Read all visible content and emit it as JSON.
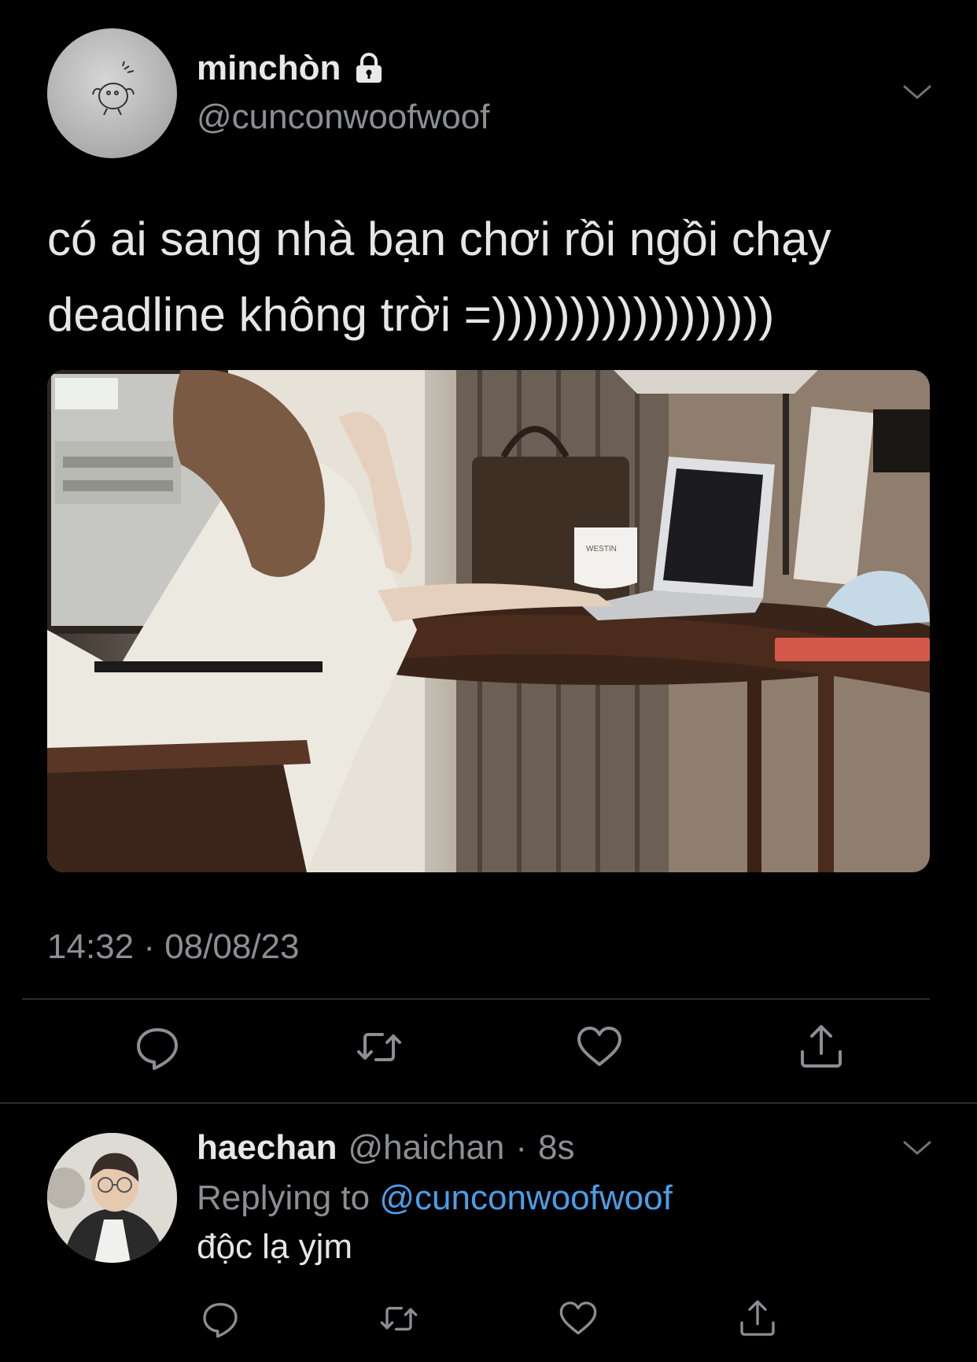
{
  "tweet": {
    "display_name": "minchòn",
    "handle": "@cunconwoofwoof",
    "text": "có ai sang nhà bạn chơi rồi ngồi chạy\ndeadline không trời =))))))))))))))))))",
    "timestamp": "14:32 · 08/08/23",
    "icons": {
      "lock": "lock-icon",
      "chevron": "chevron-down-icon"
    },
    "photo_text": "WESTIN"
  },
  "actions": {
    "reply": "reply-icon",
    "retweet": "retweet-icon",
    "like": "heart-icon",
    "share": "share-icon"
  },
  "reply": {
    "display_name": "haechan",
    "handle": "@haichan",
    "dot": "·",
    "time": "8s",
    "replying_prefix": "Replying to",
    "replying_mention": "@cunconwoofwoof",
    "text": "độc lạ yjm"
  },
  "colors": {
    "background": "#000000",
    "secondary_text": "#8b8f94",
    "mention": "#4a9fe8",
    "divider": "#2a2d31"
  }
}
